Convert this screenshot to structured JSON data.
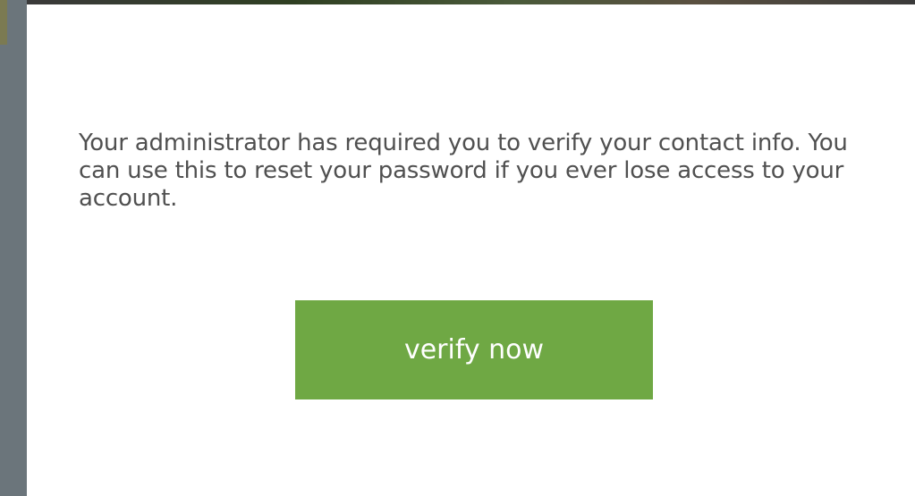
{
  "message": "Your administrator has required you to verify your contact info. You can use this to reset your password if you ever lose access to your account.",
  "verify_button": {
    "label": "verify now"
  },
  "colors": {
    "button_green": "#6fa844",
    "text_gray": "#505050",
    "side_bar": "#6b757b"
  }
}
